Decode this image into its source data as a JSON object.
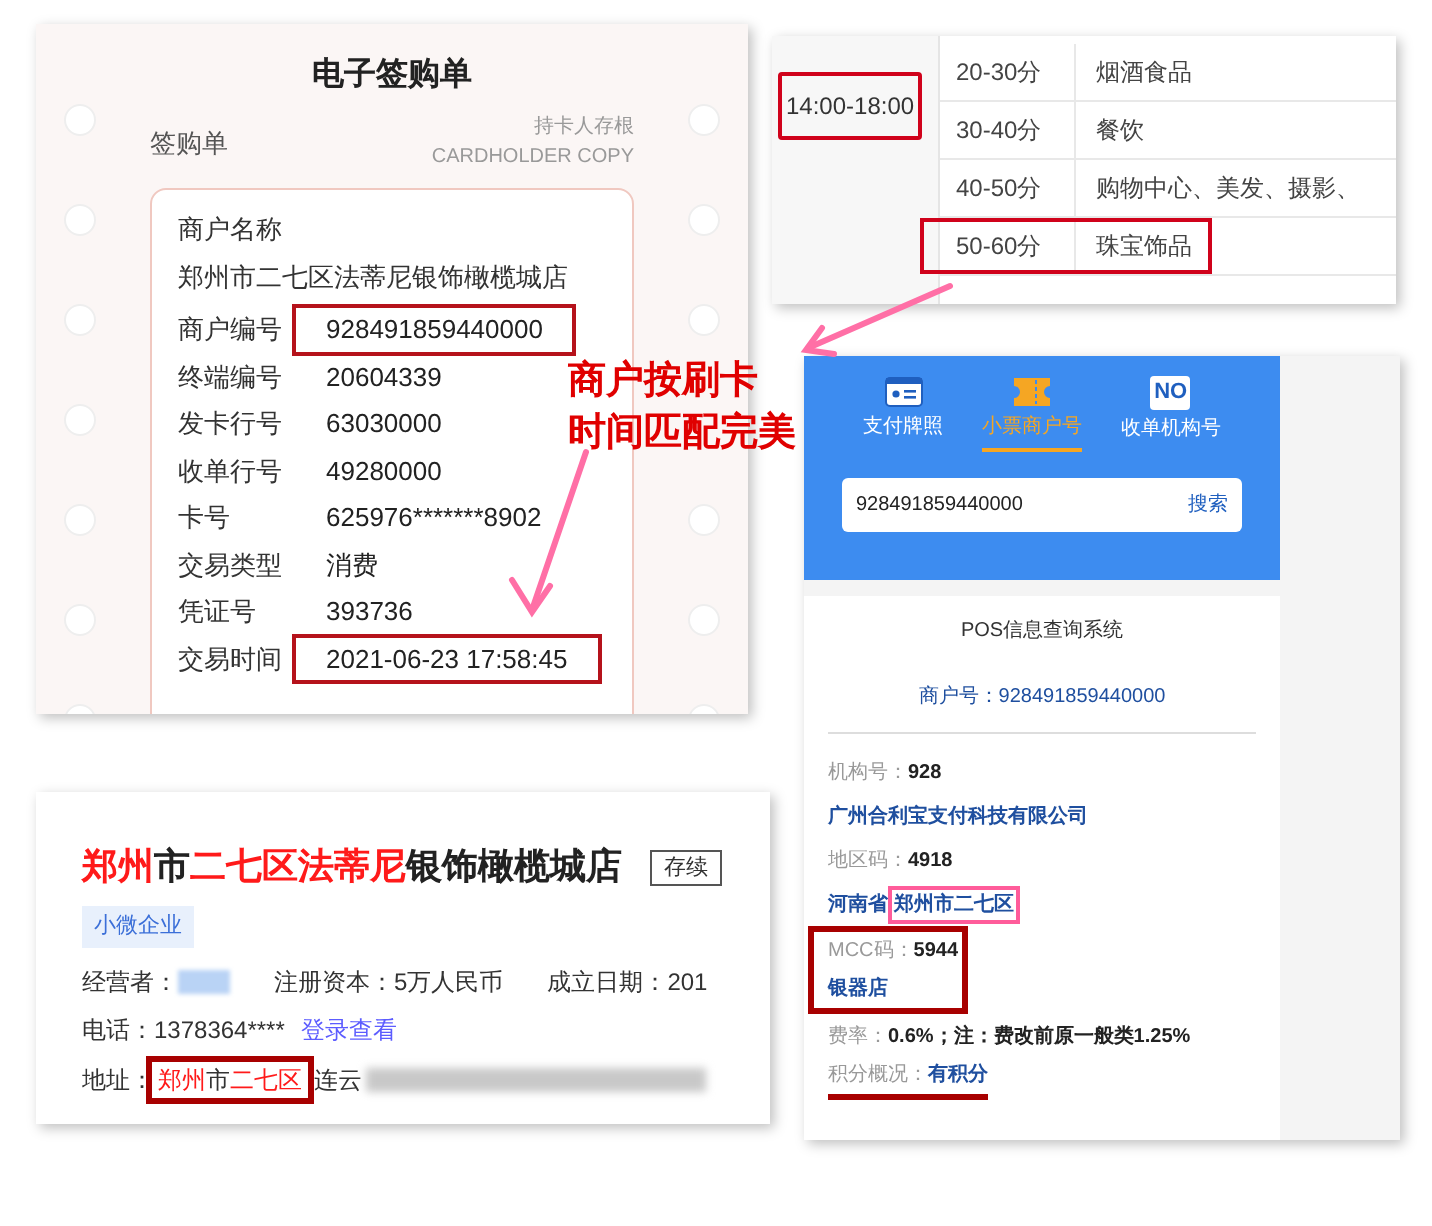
{
  "receipt": {
    "title": "电子签购单",
    "subtitle": "签购单",
    "copy_cn": "持卡人存根",
    "copy_en": "CARDHOLDER COPY",
    "name_label": "商户名称",
    "name_value": "郑州市二七区法蒂尼银饰橄榄城店",
    "rows": [
      {
        "label": "商户编号",
        "value": "928491859440000",
        "highlighted": true
      },
      {
        "label": "终端编号",
        "value": "20604339",
        "highlighted": false
      },
      {
        "label": "发卡行号",
        "value": "63030000",
        "highlighted": false
      },
      {
        "label": "收单行号",
        "value": "49280000",
        "highlighted": false
      },
      {
        "label": "卡号",
        "value": "625976*******8902",
        "highlighted": false
      },
      {
        "label": "交易类型",
        "value": "消费",
        "highlighted": false
      },
      {
        "label": "凭证号",
        "value": "393736",
        "highlighted": false
      },
      {
        "label": "交易时间",
        "value": "2021-06-23 17:58:45",
        "highlighted": true
      }
    ]
  },
  "rate_table": {
    "time": "14:00-18:00",
    "time_highlighted": true,
    "rows": [
      {
        "points": "20-30分",
        "category": "烟酒食品",
        "highlighted": false
      },
      {
        "points": "30-40分",
        "category": "餐饮",
        "highlighted": false
      },
      {
        "points": "40-50分",
        "category": "购物中心、美发、摄影、",
        "highlighted": false
      },
      {
        "points": "50-60分",
        "category": "珠宝饰品",
        "highlighted": true
      }
    ]
  },
  "annotation": [
    "商户按刷卡",
    "时间匹配完美"
  ],
  "pos_app": {
    "tabs": [
      {
        "label": "支付牌照",
        "kind": "card",
        "selected": false
      },
      {
        "label": "小票商户号",
        "kind": "ticket",
        "selected": true
      },
      {
        "label": "收单机构号",
        "kind": "badge",
        "icon_text": "NO",
        "selected": false
      }
    ],
    "search": {
      "value": "928491859440000",
      "button": "搜索"
    },
    "title": "POS信息查询系统",
    "merchant_line": "商户号：928491859440000",
    "fields": [
      {
        "kind": "pair",
        "label": "机构号：",
        "value": "928",
        "red_box": false
      },
      {
        "kind": "link",
        "value": "广州合利宝支付科技有限公司",
        "red_box": false
      },
      {
        "kind": "pair",
        "label": "地区码：",
        "value": "4918",
        "red_box": false
      },
      {
        "kind": "region",
        "prefix": "河南省",
        "value": "郑州市二七区",
        "pink_box": true,
        "red_box": false
      },
      {
        "kind": "pair",
        "label": "MCC码：",
        "value": "5944",
        "red_box": true
      },
      {
        "kind": "link",
        "value": "银器店",
        "red_box": true
      },
      {
        "kind": "pair",
        "label": "费率：",
        "value": "0.6%；注：费改前原一般类1.25%",
        "red_box": false
      },
      {
        "kind": "pair_link",
        "label": "积分概况：",
        "value": "有积分",
        "underlined": true,
        "red_box": false
      }
    ]
  },
  "company": {
    "name": [
      {
        "text": "郑州",
        "highlighted": true
      },
      {
        "text": "市",
        "highlighted": false
      },
      {
        "text": "二七区法蒂尼",
        "highlighted": true
      },
      {
        "text": "银饰橄榄城店",
        "highlighted": false
      }
    ],
    "status": "存续",
    "tag": "小微企业",
    "operator_label": "经营者：",
    "capital": "注册资本：5万人民币",
    "founded": "成立日期：201",
    "phone": "电话：1378364****",
    "phone_link": "登录查看",
    "address_label": "地址：",
    "address_boxed": [
      {
        "text": "郑州",
        "highlighted": true
      },
      {
        "text": "市",
        "highlighted": false
      },
      {
        "text": "二七区",
        "highlighted": true
      }
    ],
    "address_rest": "连云"
  }
}
